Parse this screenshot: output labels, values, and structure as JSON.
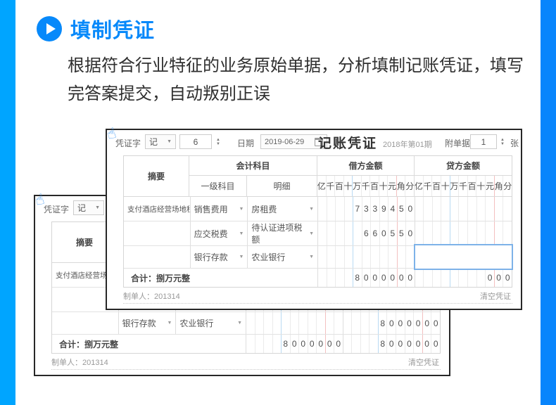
{
  "page": {
    "title": "填制凭证",
    "description": "根据符合行业特征的业务原始单据，分析填制记账凭证，填写完答案提交，自动叛别正误",
    "accent_color": "#0789fa",
    "band_left_color": "#00a5ff",
    "band_right_color": "#0885fc"
  },
  "icons": {
    "dropdown": "▼",
    "spin_up": "▲",
    "spin_down": "▼",
    "hand": "☝"
  },
  "voucher": {
    "word_label": "凭证字",
    "word_value": "记",
    "number_value": "6",
    "date_label": "日期",
    "date_value": "2019-06-29",
    "title": "记账凭证",
    "period": "2018年第01期",
    "attach_label": "附单据",
    "attach_value": "1",
    "attach_unit": "张",
    "headers": {
      "summary": "摘要",
      "subject": "会计科目",
      "subject_l1": "一级科目",
      "subject_detail": "明细",
      "debit": "借方金额",
      "credit": "贷方金额"
    },
    "digit_units": [
      "亿",
      "千",
      "百",
      "十",
      "万",
      "千",
      "百",
      "十",
      "元",
      "角",
      "分"
    ],
    "rows": [
      {
        "summary": "支付酒店经营场地租",
        "account": "销售费用",
        "detail": "房租费"
      },
      {
        "summary": "",
        "account": "应交税费",
        "detail": "待认证进项税额"
      },
      {
        "summary": "",
        "account": "银行存款",
        "detail": "农业银行"
      }
    ],
    "total_label": "合计：捌万元整",
    "footer": {
      "preparer": "制单人：201314",
      "clear": "清空凭证"
    },
    "highlight_border_color": "#7db2e8"
  },
  "front": {
    "rows_digits": [
      {
        "debit": [
          "",
          "",
          "",
          "",
          "7",
          "3",
          "3",
          "9",
          "4",
          "5",
          "0"
        ],
        "credit": [
          "",
          "",
          "",
          "",
          "",
          "",
          "",
          "",
          "",
          "",
          ""
        ]
      },
      {
        "debit": [
          "",
          "",
          "",
          "",
          "",
          "6",
          "6",
          "0",
          "5",
          "5",
          "0"
        ],
        "credit": [
          "",
          "",
          "",
          "",
          "",
          "",
          "",
          "",
          "",
          "",
          ""
        ]
      },
      {
        "debit": [
          "",
          "",
          "",
          "",
          "",
          "",
          "",
          "",
          "",
          "",
          ""
        ],
        "credit": [
          "",
          "",
          "",
          "",
          "",
          "",
          "",
          "",
          "",
          "",
          ""
        ]
      }
    ],
    "total": {
      "debit": [
        "",
        "",
        "",
        "",
        "8",
        "0",
        "0",
        "0",
        "0",
        "0",
        "0"
      ],
      "credit": [
        "",
        "",
        "",
        "",
        "",
        "",
        "",
        "",
        "0",
        "0",
        "0"
      ]
    }
  },
  "back": {
    "rows_digits": [
      {
        "debit": [
          "",
          "",
          "",
          "",
          "7",
          "3",
          "3",
          "9",
          "4",
          "5",
          "0"
        ],
        "credit": [
          "",
          "",
          "",
          "",
          "",
          "",
          "",
          "",
          "",
          "",
          ""
        ]
      },
      {
        "debit": [
          "",
          "",
          "",
          "",
          "",
          "6",
          "6",
          "0",
          "5",
          "5",
          "0"
        ],
        "credit": [
          "",
          "",
          "",
          "",
          "",
          "",
          "",
          "",
          "",
          "",
          ""
        ]
      },
      {
        "debit": [
          "",
          "",
          "",
          "",
          "",
          "",
          "",
          "",
          "",
          "",
          ""
        ],
        "credit": [
          "",
          "",
          "",
          "",
          "8",
          "0",
          "0",
          "0",
          "0",
          "0",
          "0"
        ]
      }
    ],
    "total": {
      "debit": [
        "",
        "",
        "",
        "",
        "8",
        "0",
        "0",
        "0",
        "0",
        "0",
        "0"
      ],
      "credit": [
        "",
        "",
        "",
        "",
        "8",
        "0",
        "0",
        "0",
        "0",
        "0",
        "0"
      ]
    }
  }
}
